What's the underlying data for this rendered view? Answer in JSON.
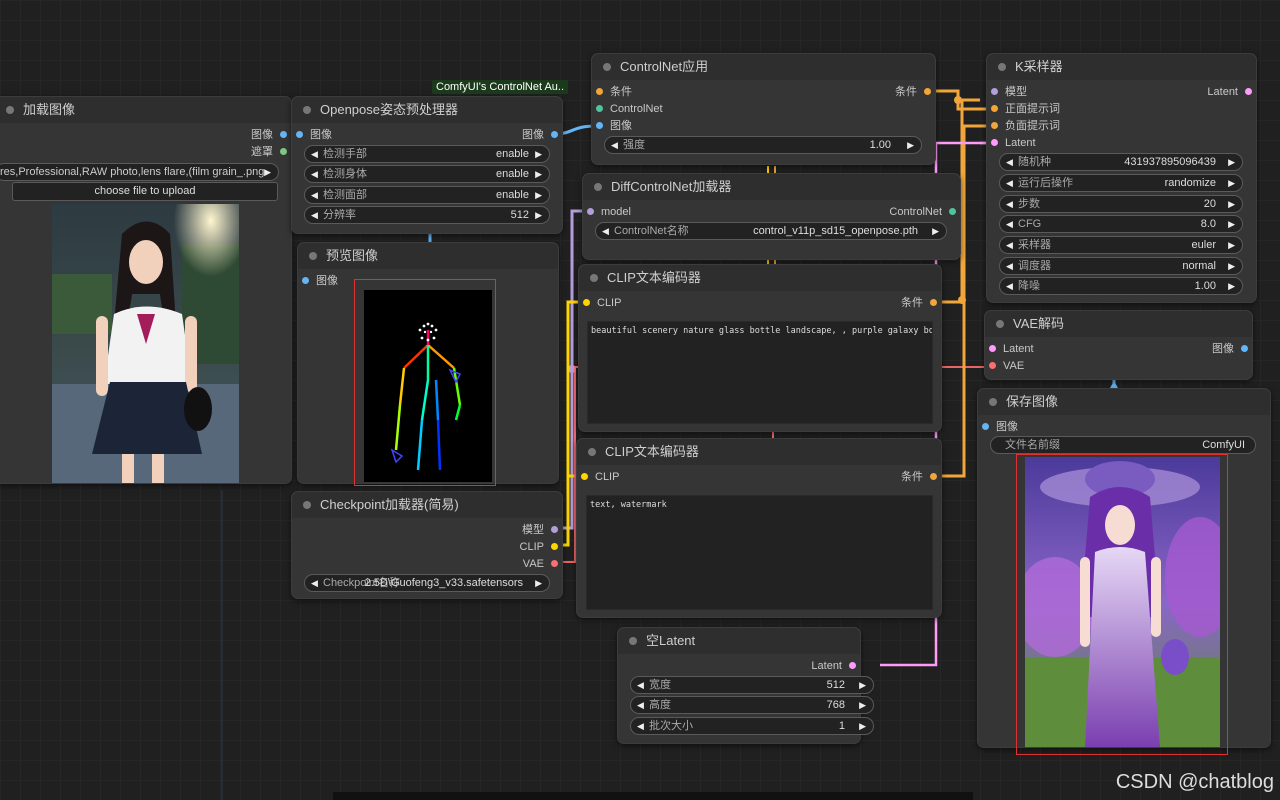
{
  "colors": {
    "conditioning": "#f0a63a",
    "controlnet": "#4fc4a0",
    "image": "#64b5f6",
    "model": "#b39ddb",
    "clip": "#ffd500",
    "vae": "#ff6e6e",
    "latent": "#ff9cf9",
    "mask": "#81c784"
  },
  "badge": "ComfyUI's ControlNet Au..",
  "watermark": "CSDN @chatblog",
  "load_image": {
    "title": "加载图像",
    "out_image": "图像",
    "out_mask": "遮罩",
    "file": "res,Professional,RAW photo,lens flare,(film grain_.png",
    "upload": "choose file to upload"
  },
  "openpose": {
    "title": "Openpose姿态预处理器",
    "in_image": "图像",
    "out_image": "图像",
    "widgets": [
      {
        "label": "检测手部",
        "value": "enable"
      },
      {
        "label": "检测身体",
        "value": "enable"
      },
      {
        "label": "检测面部",
        "value": "enable"
      },
      {
        "label": "分辨率",
        "value": "512"
      }
    ]
  },
  "preview": {
    "title": "预览图像",
    "in_image": "图像"
  },
  "checkpoint": {
    "title": "Checkpoint加载器(简易)",
    "out_model": "模型",
    "out_clip": "CLIP",
    "out_vae": "VAE",
    "widget_label": "Checkpoint名称",
    "widget_value": "2.5D\\Guofeng3_v33.safetensors"
  },
  "controlnet_apply": {
    "title": "ControlNet应用",
    "in_cond": "条件",
    "in_controlnet": "ControlNet",
    "in_image": "图像",
    "out_cond": "条件",
    "strength_label": "强度",
    "strength_value": "1.00"
  },
  "diff_controlnet": {
    "title": "DiffControlNet加载器",
    "in_model": "model",
    "out_controlnet": "ControlNet",
    "widget_label": "ControlNet名称",
    "widget_value": "control_v11p_sd15_openpose.pth"
  },
  "clip_pos": {
    "title": "CLIP文本编码器",
    "in_clip": "CLIP",
    "out_cond": "条件",
    "text": "beautiful scenery nature glass bottle landscape, , purple galaxy bottle,"
  },
  "clip_neg": {
    "title": "CLIP文本编码器",
    "in_clip": "CLIP",
    "out_cond": "条件",
    "text": "text, watermark"
  },
  "empty_latent": {
    "title": "空Latent",
    "out_latent": "Latent",
    "widgets": [
      {
        "label": "宽度",
        "value": "512"
      },
      {
        "label": "高度",
        "value": "768"
      },
      {
        "label": "批次大小",
        "value": "1"
      }
    ]
  },
  "ksampler": {
    "title": "K采样器",
    "in_model": "模型",
    "in_pos": "正面提示词",
    "in_neg": "负面提示词",
    "in_latent": "Latent",
    "out_latent": "Latent",
    "widgets": [
      {
        "label": "随机种",
        "value": "431937895096439"
      },
      {
        "label": "运行后操作",
        "value": "randomize"
      },
      {
        "label": "步数",
        "value": "20"
      },
      {
        "label": "CFG",
        "value": "8.0"
      },
      {
        "label": "采样器",
        "value": "euler"
      },
      {
        "label": "调度器",
        "value": "normal"
      },
      {
        "label": "降噪",
        "value": "1.00"
      }
    ]
  },
  "vae_decode": {
    "title": "VAE解码",
    "in_latent": "Latent",
    "in_vae": "VAE",
    "out_image": "图像"
  },
  "save_image": {
    "title": "保存图像",
    "in_image": "图像",
    "prefix_label": "文件名前缀",
    "prefix_value": "ComfyUI"
  }
}
